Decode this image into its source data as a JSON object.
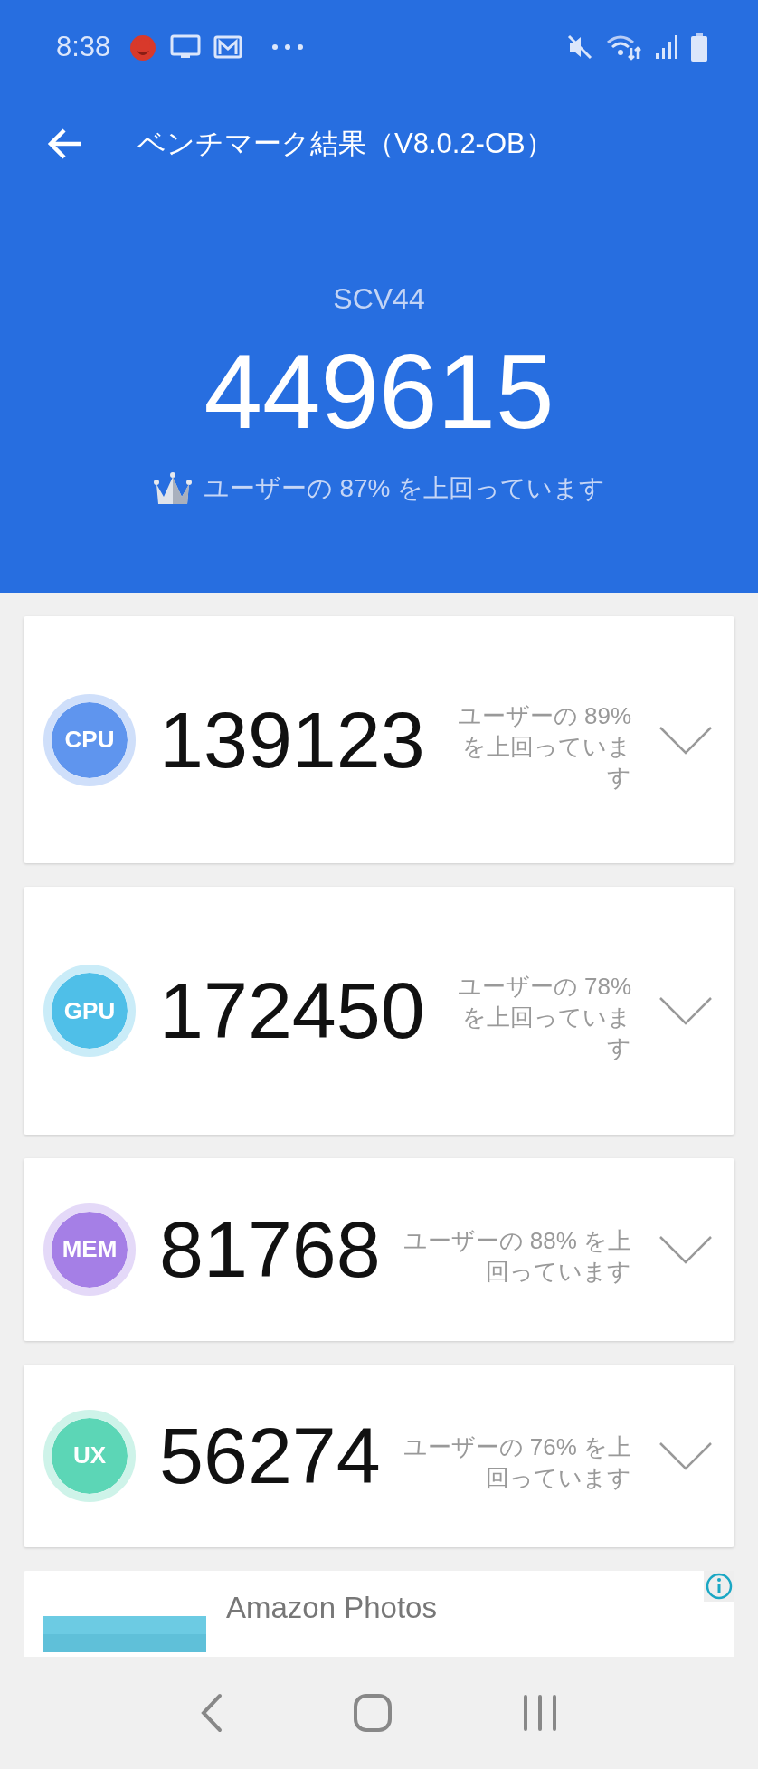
{
  "status_bar": {
    "time": "8:38"
  },
  "header": {
    "title": "ベンチマーク結果（V8.0.2-OB）",
    "device": "SCV44",
    "score": "449615",
    "rank_text": "ユーザーの 87% を上回っています"
  },
  "categories": [
    {
      "label": "CPU",
      "score": "139123",
      "rank_text": "ユーザーの 89% を上回っています",
      "color": "#5f95ee",
      "expanded": false
    },
    {
      "label": "GPU",
      "score": "172450",
      "rank_text": "ユーザーの 78% を上回っています",
      "color": "#4fbfe8",
      "expanded": false
    },
    {
      "label": "MEM",
      "score": "81768",
      "rank_text": "ユーザーの 88% を上回っています",
      "color": "#a57fe6",
      "expanded": false
    },
    {
      "label": "UX",
      "score": "56274",
      "rank_text": "ユーザーの 76% を上回っています",
      "color": "#5cd6b6",
      "expanded": false
    }
  ],
  "ad": {
    "title": "Amazon Photos"
  }
}
